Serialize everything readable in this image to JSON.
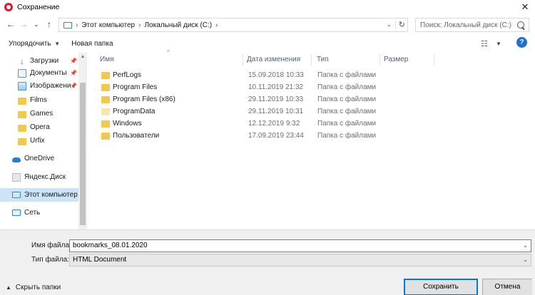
{
  "window": {
    "title": "Сохранение",
    "close": "✕"
  },
  "address": {
    "back": "←",
    "forward": "→",
    "recent": "⌄",
    "up": "↑",
    "crumbs": [
      "Этот компьютер",
      "Локальный диск (C:)"
    ],
    "separator": "›",
    "refresh": "↻"
  },
  "search": {
    "placeholder": "Поиск: Локальный диск (C:)"
  },
  "toolbar": {
    "organize": "Упорядочить",
    "new_folder": "Новая папка",
    "help": "?"
  },
  "nav": {
    "items": [
      {
        "label": "Загрузки",
        "icon": "downloads-icon",
        "pinned": true
      },
      {
        "label": "Документы",
        "icon": "documents-icon",
        "pinned": true
      },
      {
        "label": "Изображени",
        "icon": "pictures-icon",
        "pinned": true
      },
      {
        "label": "Films",
        "icon": "folder-icon"
      },
      {
        "label": "Games",
        "icon": "folder-icon"
      },
      {
        "label": "Opera",
        "icon": "folder-icon"
      },
      {
        "label": "Urfix",
        "icon": "folder-icon"
      },
      {
        "label": "OneDrive",
        "icon": "onedrive-icon"
      },
      {
        "label": "Яндекс.Диск",
        "icon": "yandex-disk-icon"
      },
      {
        "label": "Этот компьютер",
        "icon": "computer-icon",
        "selected": true
      },
      {
        "label": "Сеть",
        "icon": "network-icon"
      }
    ]
  },
  "columns": {
    "name": "Имя",
    "date": "Дата изменения",
    "type": "Тип",
    "size": "Размер"
  },
  "files": [
    {
      "name": "PerfLogs",
      "date": "15.09.2018 10:33",
      "type": "Папка с файлами"
    },
    {
      "name": "Program Files",
      "date": "10.11.2019 21:32",
      "type": "Папка с файлами"
    },
    {
      "name": "Program Files (x86)",
      "date": "29.11.2019 10:33",
      "type": "Папка с файлами"
    },
    {
      "name": "ProgramData",
      "date": "29.11.2019 10:31",
      "type": "Папка с файлами"
    },
    {
      "name": "Windows",
      "date": "12.12.2019 9:32",
      "type": "Папка с файлами"
    },
    {
      "name": "Пользователи",
      "date": "17.09.2019 23:44",
      "type": "Папка с файлами"
    }
  ],
  "form": {
    "filename_label": "Имя файла:",
    "filename_value": "bookmarks_08.01.2020",
    "filetype_label": "Тип файла:",
    "filetype_value": "HTML Document",
    "hide_folders": "Скрыть папки",
    "save": "Сохранить",
    "cancel": "Отмена"
  }
}
